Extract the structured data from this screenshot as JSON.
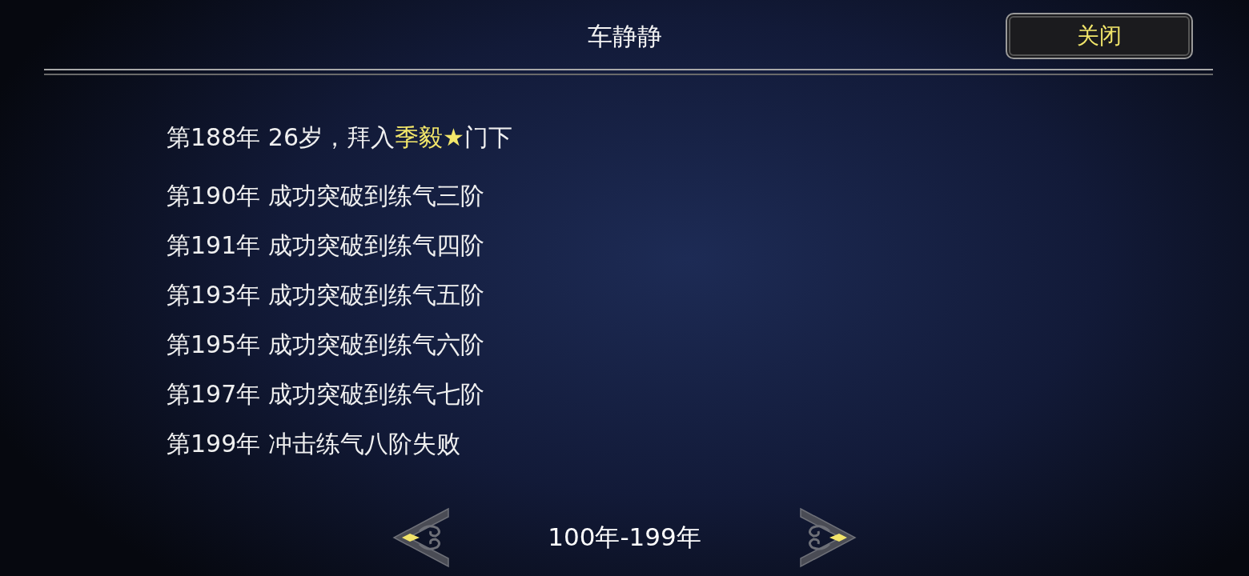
{
  "header": {
    "title": "车静静",
    "close_button": "关闭"
  },
  "entries": [
    {
      "segments": [
        {
          "text": "第188年 26岁，拜入",
          "highlight": false
        },
        {
          "text": "季毅★",
          "highlight": true
        },
        {
          "text": "门下",
          "highlight": false
        }
      ]
    },
    {
      "segments": [
        {
          "text": "第190年 成功突破到练气三阶",
          "highlight": false
        }
      ]
    },
    {
      "segments": [
        {
          "text": "第191年 成功突破到练气四阶",
          "highlight": false
        }
      ]
    },
    {
      "segments": [
        {
          "text": "第193年 成功突破到练气五阶",
          "highlight": false
        }
      ]
    },
    {
      "segments": [
        {
          "text": "第195年 成功突破到练气六阶",
          "highlight": false
        }
      ]
    },
    {
      "segments": [
        {
          "text": "第197年 成功突破到练气七阶",
          "highlight": false
        }
      ]
    },
    {
      "segments": [
        {
          "text": "第199年 冲击练气八阶失败",
          "highlight": false
        }
      ]
    }
  ],
  "pager": {
    "range": "100年-199年"
  }
}
